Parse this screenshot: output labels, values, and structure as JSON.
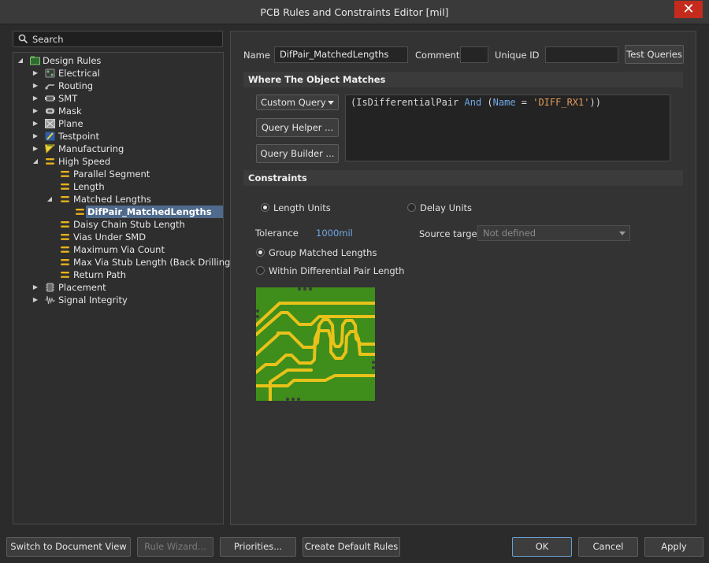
{
  "window": {
    "title": "PCB Rules and Constraints Editor [mil]",
    "close": "✕"
  },
  "search": {
    "placeholder": "Search"
  },
  "tree": {
    "root": "Design Rules",
    "items": [
      {
        "label": "Electrical"
      },
      {
        "label": "Routing"
      },
      {
        "label": "SMT"
      },
      {
        "label": "Mask"
      },
      {
        "label": "Plane"
      },
      {
        "label": "Testpoint"
      },
      {
        "label": "Manufacturing"
      },
      {
        "label": "High Speed"
      },
      {
        "label": "Parallel Segment"
      },
      {
        "label": "Length"
      },
      {
        "label": "Matched Lengths"
      },
      {
        "label": "DifPair_MatchedLengths"
      },
      {
        "label": "Daisy Chain Stub Length"
      },
      {
        "label": "Vias Under SMD"
      },
      {
        "label": "Maximum Via Count"
      },
      {
        "label": "Max Via Stub Length (Back Drilling)"
      },
      {
        "label": "Return Path"
      },
      {
        "label": "Placement"
      },
      {
        "label": "Signal Integrity"
      }
    ]
  },
  "rule": {
    "name_label": "Name",
    "name_value": "DifPair_MatchedLengths",
    "comment_label": "Comment",
    "comment_value": "",
    "uid_label": "Unique ID",
    "uid_value": "",
    "test_queries": "Test Queries"
  },
  "match": {
    "heading": "Where The Object Matches",
    "mode": "Custom Query",
    "query_helper": "Query Helper ...",
    "query_builder": "Query Builder ...",
    "query": {
      "p1": "(IsDifferentialPair ",
      "k1": "And",
      "p2": " (",
      "k2": "Name",
      "p3": " = ",
      "s1": "'DIFF_RX1'",
      "p4": "))"
    }
  },
  "constraints": {
    "heading": "Constraints",
    "length_units": "Length Units",
    "delay_units": "Delay Units",
    "tolerance_label": "Tolerance",
    "tolerance_value": "1000mil",
    "source_target_label": "Source target",
    "source_target_value": "Not defined",
    "group_matched": "Group Matched Lengths",
    "within_pair": "Within Differential Pair Length"
  },
  "footer": {
    "switch_view": "Switch to Document View",
    "rule_wizard": "Rule Wizard...",
    "priorities": "Priorities...",
    "create_default": "Create Default Rules",
    "ok": "OK",
    "cancel": "Cancel",
    "apply": "Apply"
  },
  "colors": {
    "accent": "#4e6a8c",
    "pcb_board": "#3f8d1b",
    "pcb_trace": "#e8c21a",
    "close": "#c42b1c"
  }
}
